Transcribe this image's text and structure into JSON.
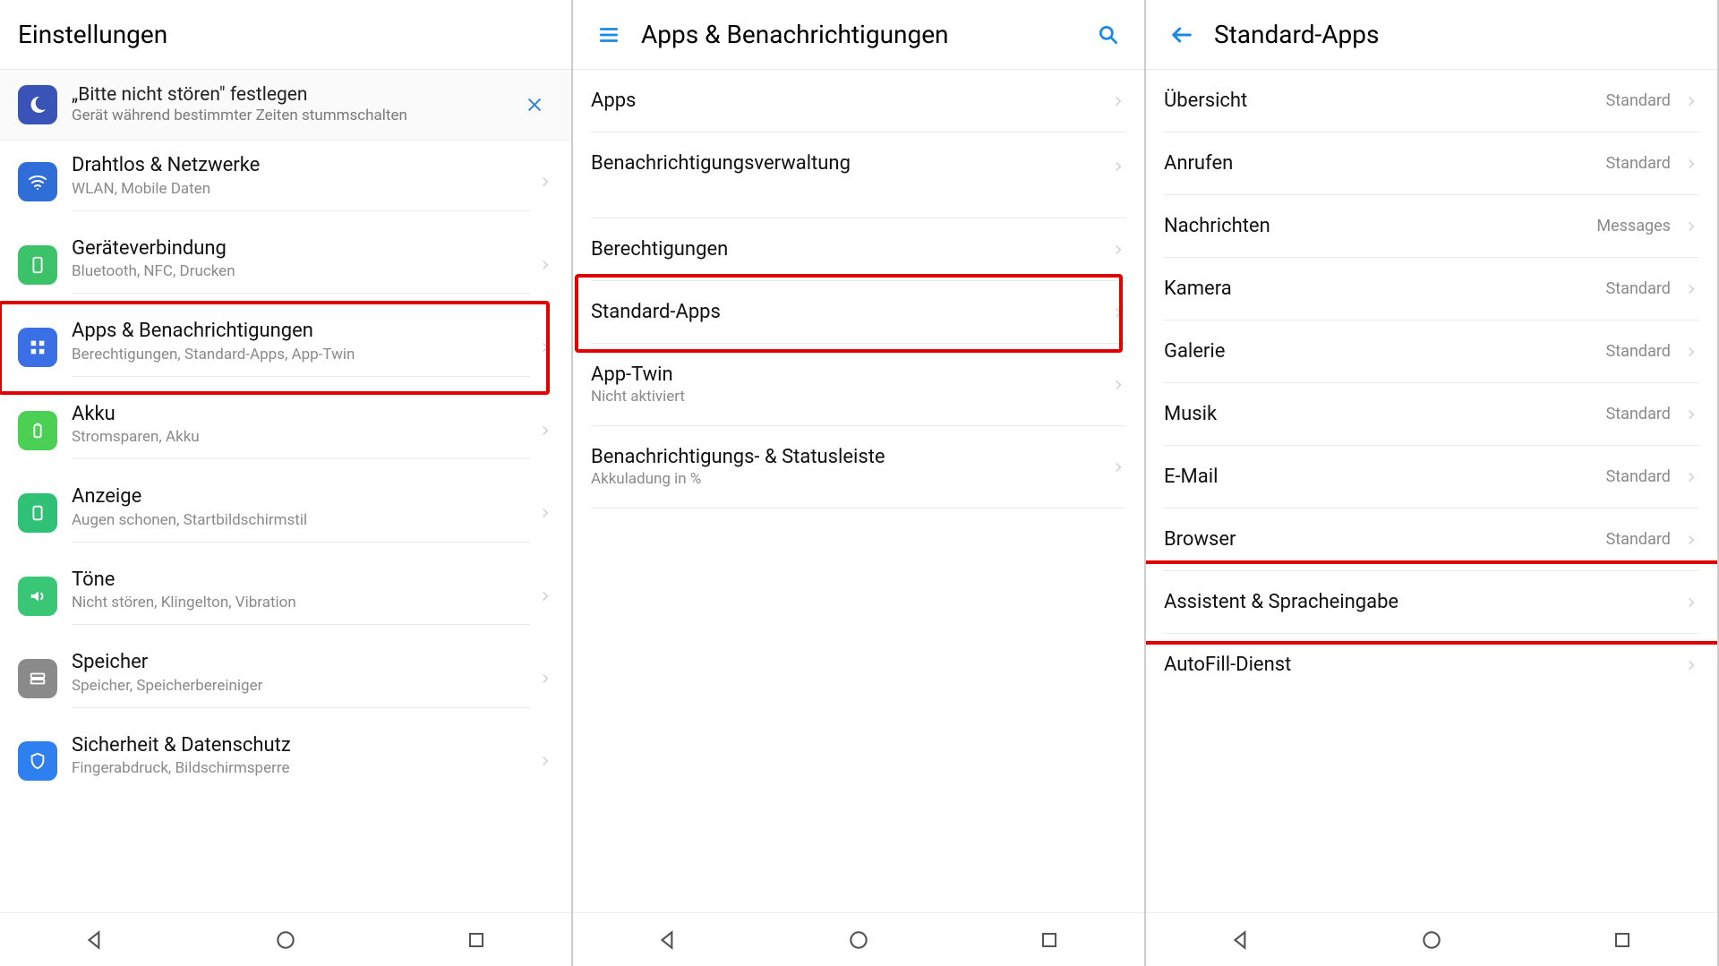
{
  "panel1": {
    "title": "Einstellungen",
    "banner": {
      "title": "„Bitte nicht stören\" festlegen",
      "sub": "Gerät während bestimmter Zeiten stummschalten"
    },
    "items": [
      {
        "title": "Drahtlos & Netzwerke",
        "sub": "WLAN, Mobile Daten"
      },
      {
        "title": "Geräteverbindung",
        "sub": "Bluetooth, NFC, Drucken"
      },
      {
        "title": "Apps & Benachrichtigungen",
        "sub": "Berechtigungen, Standard-Apps, App-Twin"
      },
      {
        "title": "Akku",
        "sub": "Stromsparen, Akku"
      },
      {
        "title": "Anzeige",
        "sub": "Augen schonen, Startbildschirmstil"
      },
      {
        "title": "Töne",
        "sub": "Nicht stören, Klingelton, Vibration"
      },
      {
        "title": "Speicher",
        "sub": "Speicher, Speicherbereiniger"
      },
      {
        "title": "Sicherheit & Datenschutz",
        "sub": "Fingerabdruck, Bildschirmsperre"
      }
    ],
    "highlight_index": 2
  },
  "panel2": {
    "title": "Apps & Benachrichtigungen",
    "items": [
      {
        "title": "Apps"
      },
      {
        "title": "Benachrichtigungsverwaltung"
      },
      {
        "title": "Berechtigungen"
      },
      {
        "title": "Standard-Apps"
      },
      {
        "title": "App-Twin",
        "sub": "Nicht aktiviert"
      },
      {
        "title": "Benachrichtigungs- & Statusleiste",
        "sub": "Akkuladung in %"
      }
    ],
    "highlight_index": 3
  },
  "panel3": {
    "title": "Standard-Apps",
    "items": [
      {
        "title": "Übersicht",
        "value": "Standard"
      },
      {
        "title": "Anrufen",
        "value": "Standard"
      },
      {
        "title": "Nachrichten",
        "value": "Messages"
      },
      {
        "title": "Kamera",
        "value": "Standard"
      },
      {
        "title": "Galerie",
        "value": "Standard"
      },
      {
        "title": "Musik",
        "value": "Standard"
      },
      {
        "title": "E-Mail",
        "value": "Standard"
      },
      {
        "title": "Browser",
        "value": "Standard"
      },
      {
        "title": "Assistent & Spracheingabe"
      },
      {
        "title": "AutoFill-Dienst"
      }
    ],
    "highlight_index": 8
  }
}
